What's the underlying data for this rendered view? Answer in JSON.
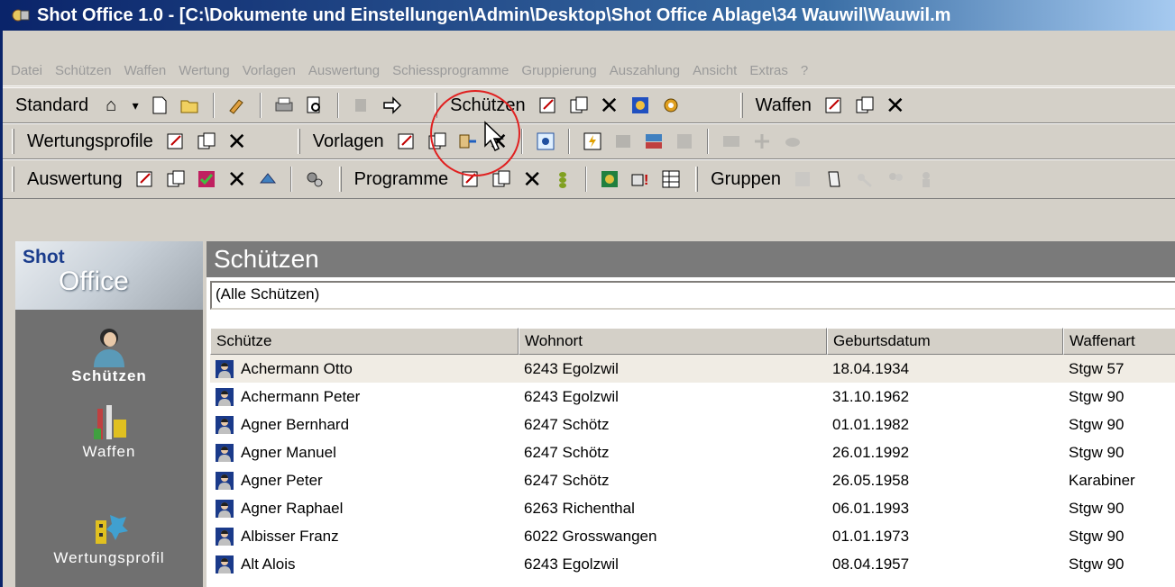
{
  "window": {
    "title": "Shot Office 1.0 - [C:\\Dokumente und Einstellungen\\Admin\\Desktop\\Shot Office Ablage\\34 Wauwil\\Wauwil.m"
  },
  "menu": [
    "Datei",
    "Schützen",
    "Waffen",
    "Wertung",
    "Vorlagen",
    "Auswertung",
    "Schiessprogramme",
    "Gruppierung",
    "Auszahlung",
    "Ansicht",
    "Extras",
    "?"
  ],
  "toolbars": {
    "standard": "Standard",
    "schuetzen": "Schützen",
    "waffen": "Waffen",
    "wertungsprofile": "Wertungsprofile",
    "vorlagen": "Vorlagen",
    "auswertung": "Auswertung",
    "programme": "Programme",
    "gruppen": "Gruppen"
  },
  "sidebar": {
    "logo_top": "Shot",
    "logo_bottom": "Office",
    "items": [
      {
        "label": "Schützen",
        "icon": "shooter-icon"
      },
      {
        "label": "Waffen",
        "icon": "weapons-icon"
      },
      {
        "label": "Wertungsprofil",
        "icon": "rating-profile-icon"
      }
    ]
  },
  "main": {
    "header": "Schützen",
    "filter": "(Alle Schützen)",
    "columns": [
      "Schütze",
      "Wohnort",
      "Geburtsdatum",
      "Waffenart"
    ],
    "rows": [
      [
        "Achermann Otto",
        "6243 Egolzwil",
        "18.04.1934",
        "Stgw 57"
      ],
      [
        "Achermann Peter",
        "6243 Egolzwil",
        "31.10.1962",
        "Stgw 90"
      ],
      [
        "Agner Bernhard",
        "6247 Schötz",
        "01.01.1982",
        "Stgw 90"
      ],
      [
        "Agner Manuel",
        "6247 Schötz",
        "26.01.1992",
        "Stgw 90"
      ],
      [
        "Agner Peter",
        "6247 Schötz",
        "26.05.1958",
        "Karabiner"
      ],
      [
        "Agner Raphael",
        "6263 Richenthal",
        "06.01.1993",
        "Stgw 90"
      ],
      [
        "Albisser Franz",
        "6022 Grosswangen",
        "01.01.1973",
        "Stgw 90"
      ],
      [
        "Alt Alois",
        "6243 Egolzwil",
        "08.04.1957",
        "Stgw 90"
      ]
    ]
  },
  "colors": {
    "title_start": "#0a246a",
    "title_end": "#a6caf0",
    "highlight_circle": "#e02020",
    "sidebar_bg": "#707070",
    "header_bg": "#7a7a7a"
  }
}
